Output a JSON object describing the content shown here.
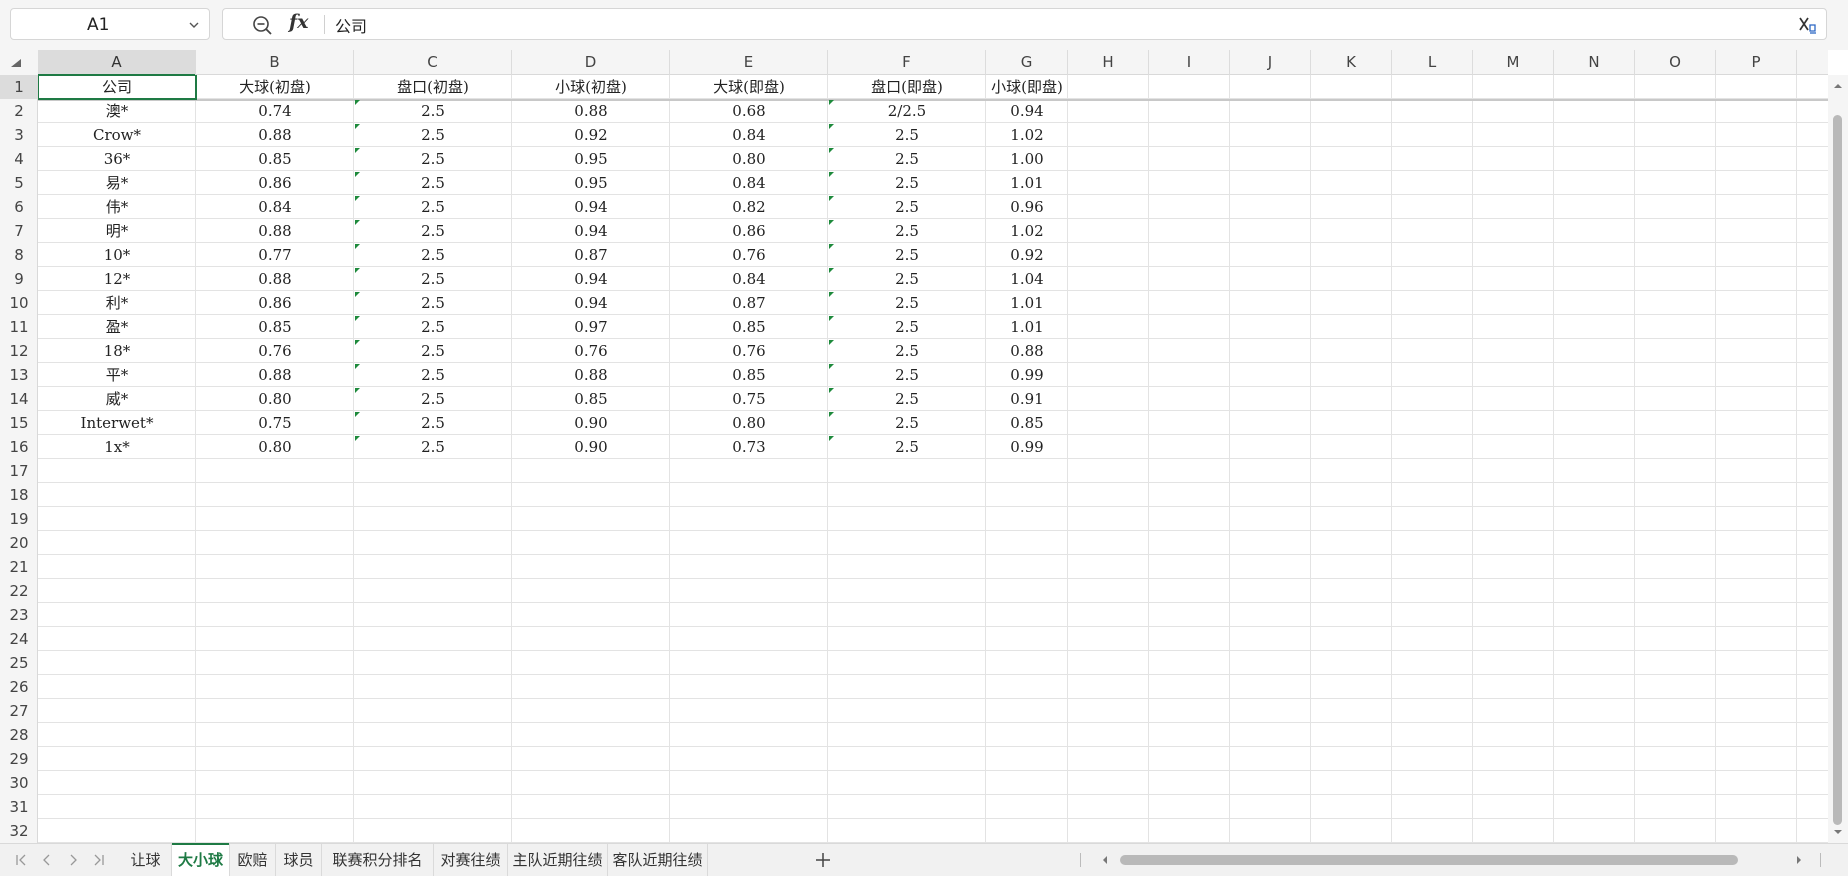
{
  "name_box": {
    "value": "A1"
  },
  "formula_bar": {
    "fx_label": "fx",
    "content": "公司"
  },
  "columns": [
    "A",
    "B",
    "C",
    "D",
    "E",
    "F",
    "G",
    "H",
    "I",
    "J",
    "K",
    "L",
    "M",
    "N",
    "O",
    "P"
  ],
  "rows": [
    "1",
    "2",
    "3",
    "4",
    "5",
    "6",
    "7",
    "8",
    "9",
    "10",
    "11",
    "12",
    "13",
    "14",
    "15",
    "16",
    "17",
    "18",
    "19",
    "20",
    "21",
    "22",
    "23",
    "24",
    "25",
    "26",
    "27",
    "28",
    "29",
    "30",
    "31",
    "32"
  ],
  "table": {
    "headers": [
      "公司",
      "大球(初盘)",
      "盘口(初盘)",
      "小球(初盘)",
      "大球(即盘)",
      "盘口(即盘)",
      "小球(即盘)"
    ],
    "rows": [
      [
        "澳*",
        "0.74",
        "2.5",
        "0.88",
        "0.68",
        "2/2.5",
        "0.94"
      ],
      [
        "Crow*",
        "0.88",
        "2.5",
        "0.92",
        "0.84",
        "2.5",
        "1.02"
      ],
      [
        "36*",
        "0.85",
        "2.5",
        "0.95",
        "0.80",
        "2.5",
        "1.00"
      ],
      [
        "易*",
        "0.86",
        "2.5",
        "0.95",
        "0.84",
        "2.5",
        "1.01"
      ],
      [
        "伟*",
        "0.84",
        "2.5",
        "0.94",
        "0.82",
        "2.5",
        "0.96"
      ],
      [
        "明*",
        "0.88",
        "2.5",
        "0.94",
        "0.86",
        "2.5",
        "1.02"
      ],
      [
        "10*",
        "0.77",
        "2.5",
        "0.87",
        "0.76",
        "2.5",
        "0.92"
      ],
      [
        "12*",
        "0.88",
        "2.5",
        "0.94",
        "0.84",
        "2.5",
        "1.04"
      ],
      [
        "利*",
        "0.86",
        "2.5",
        "0.94",
        "0.87",
        "2.5",
        "1.01"
      ],
      [
        "盈*",
        "0.85",
        "2.5",
        "0.97",
        "0.85",
        "2.5",
        "1.01"
      ],
      [
        "18*",
        "0.76",
        "2.5",
        "0.76",
        "0.76",
        "2.5",
        "0.88"
      ],
      [
        "平*",
        "0.88",
        "2.5",
        "0.88",
        "0.85",
        "2.5",
        "0.99"
      ],
      [
        "威*",
        "0.80",
        "2.5",
        "0.85",
        "0.75",
        "2.5",
        "0.91"
      ],
      [
        "Interwet*",
        "0.75",
        "2.5",
        "0.90",
        "0.80",
        "2.5",
        "0.85"
      ],
      [
        "1x*",
        "0.80",
        "2.5",
        "0.90",
        "0.73",
        "2.5",
        "0.99"
      ]
    ]
  },
  "sheet_tabs": [
    "让球",
    "大小球",
    "欧赔",
    "球员",
    "联赛积分排名",
    "对赛往绩",
    "主队近期往绩",
    "客队近期往绩"
  ],
  "active_sheet": "大小球",
  "colors": {
    "accent": "#1e7a44",
    "text_marker": "#1e8a3c",
    "header_bg": "#f5f5f5"
  }
}
